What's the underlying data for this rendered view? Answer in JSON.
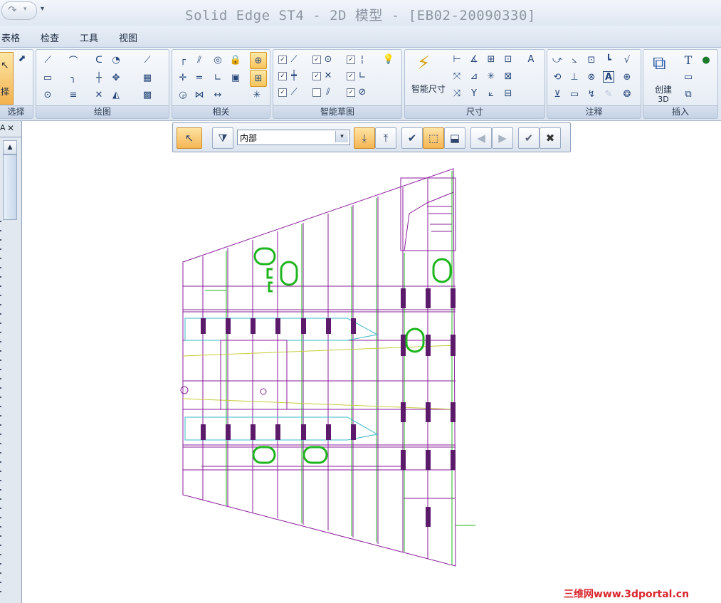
{
  "window": {
    "title": "Solid Edge ST4 - 2D 模型 - [EB02-20090330]",
    "quick_access_arrow": "▾"
  },
  "menu": {
    "items": [
      "表格",
      "检查",
      "工具",
      "视图"
    ]
  },
  "ribbon": {
    "groups": {
      "select": "选择",
      "draw": "绘图",
      "relate": "相关",
      "intellisketch": "智能草图",
      "dimension": "尺寸",
      "annotation": "注释",
      "insert": "插入"
    },
    "select_button_label": "择",
    "smart_dimension_label": "智能尺寸",
    "create_3d_label_line1": "创建",
    "create_3d_label_line2": "3D",
    "annotation_letter": "A",
    "insert_text_icon": "T"
  },
  "command_bar": {
    "filter_value": "内部",
    "filter_arrow": "▾"
  },
  "left_panel": {
    "close_glyph": "✕"
  },
  "watermark": "三维网www.3dportal.cn",
  "colors": {
    "purple_geometry": "#8a1c9a",
    "green_geometry": "#1fb51f",
    "cyan_geometry": "#3cb8c8",
    "yellow_geometry": "#c8cc3a",
    "accent_orange": "#f5b553"
  }
}
